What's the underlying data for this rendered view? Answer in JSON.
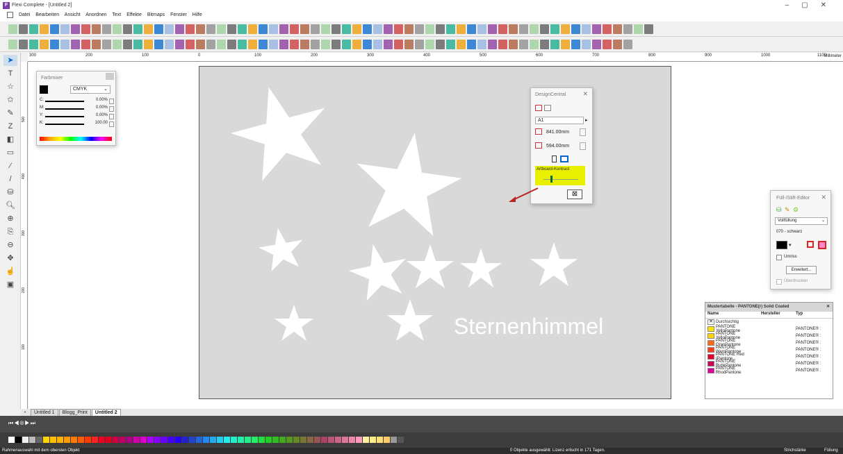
{
  "window": {
    "title": "Flexi Complete - [Untitled 2]",
    "app_icon": "F"
  },
  "menu": [
    "Datei",
    "Bearbeiten",
    "Ansicht",
    "Anordnen",
    "Text",
    "Effekte",
    "Bitmaps",
    "Fenster",
    "Hilfe"
  ],
  "ruler": {
    "h_labels": [
      "300",
      "200",
      "100",
      "0",
      "100",
      "200",
      "300",
      "400",
      "500",
      "600",
      "700",
      "800",
      "900",
      "1000",
      "1100"
    ],
    "unit": "Millimeter",
    "v_labels": [
      "500",
      "400",
      "300",
      "200",
      "100"
    ]
  },
  "farbmixer": {
    "title": "Farbmixer",
    "mode": "CMYK",
    "channels": [
      {
        "label": "C:",
        "value": "0.00%"
      },
      {
        "label": "M:",
        "value": "0.00%"
      },
      {
        "label": "Y:",
        "value": "0.00%"
      },
      {
        "label": "K:",
        "value": "100.00"
      }
    ]
  },
  "designcentral": {
    "title": "DesignCentral",
    "size": "A1",
    "width": "841.00mm",
    "height": "594.00mm",
    "contrast_label": "Artboard-Kontrast"
  },
  "fill_editor": {
    "title": "Füll-/Stift-Editor",
    "fill_type": "Vollfüllung",
    "color_name": "070 - schwarz",
    "outline": "Umriss",
    "advanced": "Erweitert...",
    "overprint": "Überdrucken"
  },
  "mustertable": {
    "title": "Mustertabelle - PANTONE(r) Solid Coated",
    "cols": [
      "Name",
      "Hersteller",
      "Typ"
    ],
    "rows": [
      {
        "name": "Durchsichtig",
        "maker": "",
        "type": "",
        "color": "none"
      },
      {
        "name": "PANTONE YelloPantone",
        "maker": "",
        "type": "PANTONE® :",
        "color": "#ffe100"
      },
      {
        "name": "PANTONE YelloPantone",
        "maker": "",
        "type": "PANTONE® :",
        "color": "#ffd400"
      },
      {
        "name": "PANTONE OranPantone",
        "maker": "",
        "type": "PANTONE® :",
        "color": "#ff6a13"
      },
      {
        "name": "PANTONE WarnPantone",
        "maker": "",
        "type": "PANTONE® :",
        "color": "#ff3b1a"
      },
      {
        "name": "PANTONE Red (Pantone",
        "maker": "",
        "type": "PANTONE® :",
        "color": "#e4002b"
      },
      {
        "name": "PANTONE RubirPantone",
        "maker": "",
        "type": "PANTONE® :",
        "color": "#ce0058"
      },
      {
        "name": "PANTONE RhodPantone",
        "maker": "",
        "type": "PANTONE® :",
        "color": "#e10098"
      }
    ]
  },
  "artboard_text": "Sternenhimmel",
  "tabs": [
    "Untitled 1",
    "Blogg_Print",
    "Untitled 2"
  ],
  "status": {
    "left": "Rahmenauswahl mit dem obersten Objekt",
    "center": "0 Objekte ausgewählt: Lizenz erlischt in 171 Tagen.",
    "stroke": "Strichstärke",
    "fill": "Füllung"
  }
}
